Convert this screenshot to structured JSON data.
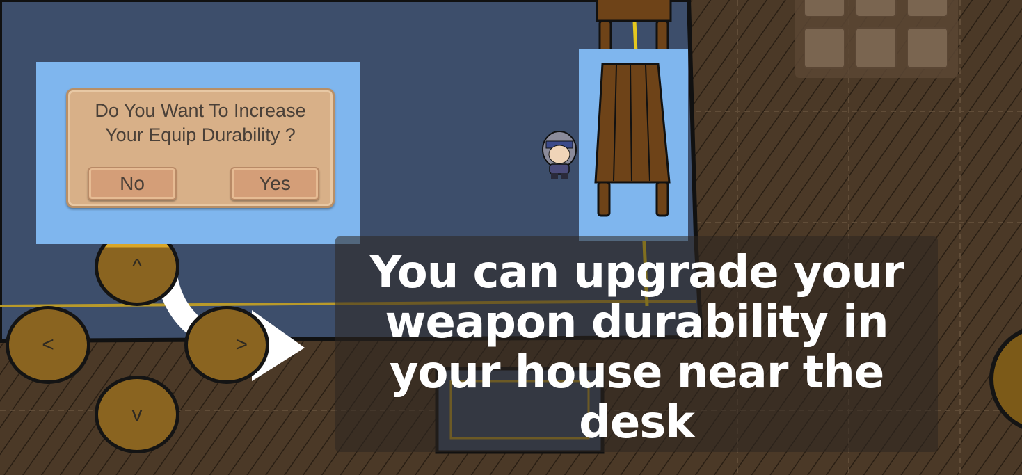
{
  "dialog": {
    "message": "Do You Want To Increase\nYour Equip Durability ?",
    "no_label": "No",
    "yes_label": "Yes"
  },
  "tutorial": {
    "text": "You can upgrade your weapon durability in your house near the desk"
  },
  "dpad": {
    "up": "^",
    "left": "<",
    "right": ">",
    "down": "v"
  },
  "colors": {
    "highlight": "#7fb6ee",
    "room_floor": "#3d4e6b",
    "outside_ground": "#4a3826",
    "dialog_panel": "#d8b088",
    "dpad_fill": "#8a6420"
  }
}
